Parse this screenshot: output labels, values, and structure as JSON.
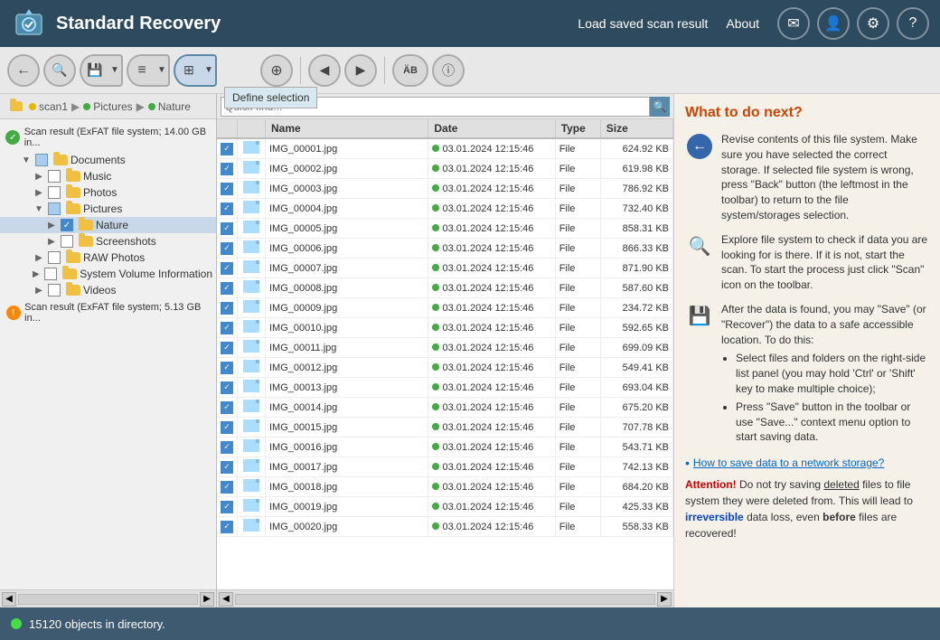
{
  "header": {
    "title": "Standard Recovery",
    "nav": [
      {
        "label": "Load saved scan result",
        "id": "load-scan"
      },
      {
        "label": "About",
        "id": "about"
      }
    ],
    "icons": [
      {
        "name": "message-icon",
        "symbol": "✉"
      },
      {
        "name": "user-icon",
        "symbol": "👤"
      },
      {
        "name": "settings-icon",
        "symbol": "⚙"
      },
      {
        "name": "help-icon",
        "symbol": "?"
      }
    ]
  },
  "toolbar": {
    "buttons": [
      {
        "name": "back-button",
        "symbol": "←",
        "active": false
      },
      {
        "name": "scan-button",
        "symbol": "🔍",
        "active": false
      },
      {
        "name": "save-button",
        "symbol": "💾",
        "active": false,
        "has_dropdown": true
      },
      {
        "name": "list-button",
        "symbol": "≡",
        "active": false,
        "has_dropdown": true
      },
      {
        "name": "select-button",
        "symbol": "⊞",
        "active": true,
        "has_dropdown": true
      },
      {
        "name": "find-button",
        "symbol": "⊕",
        "active": false
      },
      {
        "name": "prev-button",
        "symbol": "◀",
        "active": false
      },
      {
        "name": "next-button",
        "symbol": "▶",
        "active": false
      },
      {
        "name": "rename-button",
        "symbol": "AB",
        "active": false
      },
      {
        "name": "info-button",
        "symbol": "ℹ",
        "active": false
      }
    ],
    "define_selection_popup": "Define selection"
  },
  "breadcrumb": {
    "items": [
      {
        "label": "scan1",
        "dot_color": "yellow"
      },
      {
        "label": "Pictures",
        "dot_color": "green"
      },
      {
        "label": "Nature",
        "dot_color": "green"
      }
    ]
  },
  "tree": {
    "scan_result_1": "Scan result (ExFAT file system; 14.00 GB in...",
    "scan_result_2": "Scan result (ExFAT file system; 5.13 GB in...",
    "items": [
      {
        "label": "Documents",
        "indent": 1,
        "checked": "partial",
        "type": "folder",
        "expanded": true
      },
      {
        "label": "Music",
        "indent": 2,
        "checked": "unchecked",
        "type": "folder"
      },
      {
        "label": "Photos",
        "indent": 2,
        "checked": "unchecked",
        "type": "folder"
      },
      {
        "label": "Pictures",
        "indent": 2,
        "checked": "partial",
        "type": "folder",
        "expanded": true
      },
      {
        "label": "Nature",
        "indent": 3,
        "checked": "checked",
        "type": "folder",
        "selected": true
      },
      {
        "label": "Screenshots",
        "indent": 3,
        "checked": "unchecked",
        "type": "folder"
      },
      {
        "label": "RAW Photos",
        "indent": 2,
        "checked": "unchecked",
        "type": "folder"
      },
      {
        "label": "System Volume Information",
        "indent": 2,
        "checked": "unchecked",
        "type": "folder"
      },
      {
        "label": "Videos",
        "indent": 2,
        "checked": "unchecked",
        "type": "folder"
      }
    ]
  },
  "search": {
    "placeholder": "Quick find...",
    "value": ""
  },
  "file_table": {
    "columns": [
      "",
      "",
      "Name",
      "Date",
      "Type",
      "Size"
    ],
    "files": [
      {
        "name": "IMG_00001.jpg",
        "date": "03.01.2024 12:15:46",
        "type": "File",
        "size": "624.92 KB"
      },
      {
        "name": "IMG_00002.jpg",
        "date": "03.01.2024 12:15:46",
        "type": "File",
        "size": "619.98 KB"
      },
      {
        "name": "IMG_00003.jpg",
        "date": "03.01.2024 12:15:46",
        "type": "File",
        "size": "786.92 KB"
      },
      {
        "name": "IMG_00004.jpg",
        "date": "03.01.2024 12:15:46",
        "type": "File",
        "size": "732.40 KB"
      },
      {
        "name": "IMG_00005.jpg",
        "date": "03.01.2024 12:15:46",
        "type": "File",
        "size": "858.31 KB"
      },
      {
        "name": "IMG_00006.jpg",
        "date": "03.01.2024 12:15:46",
        "type": "File",
        "size": "866.33 KB"
      },
      {
        "name": "IMG_00007.jpg",
        "date": "03.01.2024 12:15:46",
        "type": "File",
        "size": "871.90 KB"
      },
      {
        "name": "IMG_00008.jpg",
        "date": "03.01.2024 12:15:46",
        "type": "File",
        "size": "587.60 KB"
      },
      {
        "name": "IMG_00009.jpg",
        "date": "03.01.2024 12:15:46",
        "type": "File",
        "size": "234.72 KB"
      },
      {
        "name": "IMG_00010.jpg",
        "date": "03.01.2024 12:15:46",
        "type": "File",
        "size": "592.65 KB"
      },
      {
        "name": "IMG_00011.jpg",
        "date": "03.01.2024 12:15:46",
        "type": "File",
        "size": "699.09 KB"
      },
      {
        "name": "IMG_00012.jpg",
        "date": "03.01.2024 12:15:46",
        "type": "File",
        "size": "549.41 KB"
      },
      {
        "name": "IMG_00013.jpg",
        "date": "03.01.2024 12:15:46",
        "type": "File",
        "size": "693.04 KB"
      },
      {
        "name": "IMG_00014.jpg",
        "date": "03.01.2024 12:15:46",
        "type": "File",
        "size": "675.20 KB"
      },
      {
        "name": "IMG_00015.jpg",
        "date": "03.01.2024 12:15:46",
        "type": "File",
        "size": "707.78 KB"
      },
      {
        "name": "IMG_00016.jpg",
        "date": "03.01.2024 12:15:46",
        "type": "File",
        "size": "543.71 KB"
      },
      {
        "name": "IMG_00017.jpg",
        "date": "03.01.2024 12:15:46",
        "type": "File",
        "size": "742.13 KB"
      },
      {
        "name": "IMG_00018.jpg",
        "date": "03.01.2024 12:15:46",
        "type": "File",
        "size": "684.20 KB"
      },
      {
        "name": "IMG_00019.jpg",
        "date": "03.01.2024 12:15:46",
        "type": "File",
        "size": "425.33 KB"
      },
      {
        "name": "IMG_00020.jpg",
        "date": "03.01.2024 12:15:46",
        "type": "File",
        "size": "558.33 KB"
      }
    ]
  },
  "right_panel": {
    "title": "What to do next?",
    "section1": {
      "text": "Revise contents of this file system. Make sure you have selected the correct storage. If selected file system is wrong, press \"Back\" button (the leftmost in the toolbar) to return to the file system/storages selection."
    },
    "section2": {
      "text": "Explore file system to check if data you are looking for is there. If it is not, start the scan. To start the process just click \"Scan\" icon on the toolbar."
    },
    "section3": {
      "text": "After the data is found, you may \"Save\" (or \"Recover\") the data to a safe accessible location. To do this:",
      "bullets": [
        "Select files and folders on the right-side list panel (you may hold 'Ctrl' or 'Shift' key to make multiple choice);",
        "Press \"Save\" button in the toolbar or use \"Save...\" context menu option to start saving data."
      ]
    },
    "link": "How to save data to a network storage?",
    "attention": {
      "prefix": "Attention!",
      "text1": " Do not try saving ",
      "deleted": "deleted",
      "text2": " files to file system they were deleted from. This will lead to ",
      "irreversible": "irreversible",
      "text3": " data loss, even ",
      "before": "before",
      "text4": " files are recovered!"
    }
  },
  "statusbar": {
    "text": "15120 objects in directory."
  }
}
